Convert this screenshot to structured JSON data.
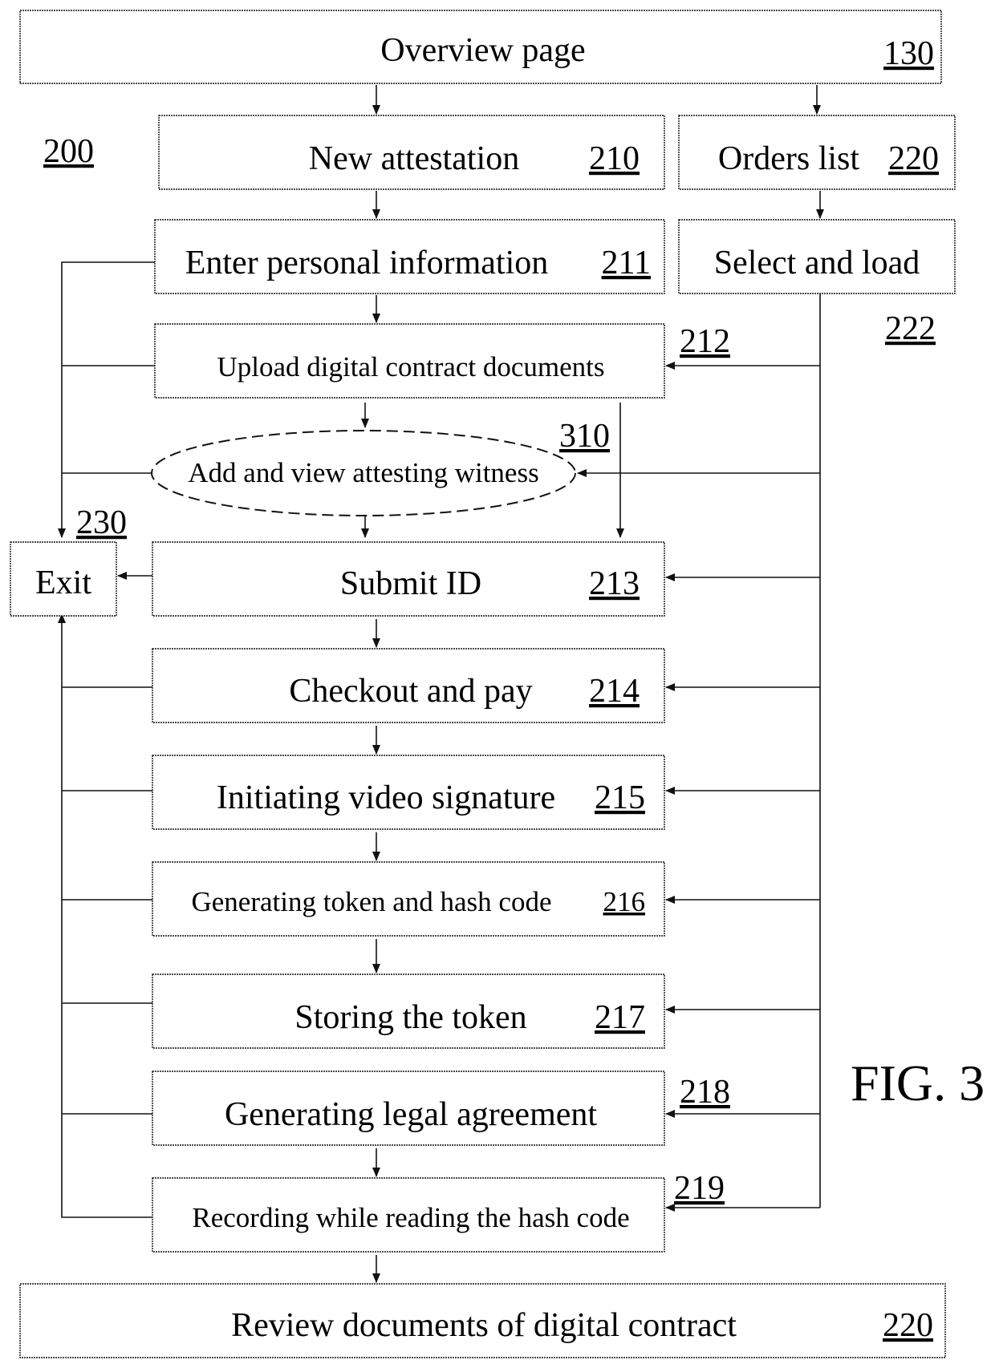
{
  "figure": {
    "title": "FIG. 3",
    "diagram_ref": "200"
  },
  "nodes": {
    "overview": {
      "label": "Overview page",
      "ref": "130"
    },
    "new_attestation": {
      "label": "New attestation",
      "ref": "210"
    },
    "orders_list": {
      "label": "Orders list",
      "ref": "220"
    },
    "enter_info": {
      "label": "Enter personal information",
      "ref": "211"
    },
    "select_load": {
      "label": "Select and load",
      "ref": "222"
    },
    "upload": {
      "label": "Upload digital contract documents",
      "ref": "212"
    },
    "witness": {
      "label": "Add and view attesting witness",
      "ref": "310"
    },
    "exit": {
      "label": "Exit",
      "ref": "230"
    },
    "submit_id": {
      "label": "Submit ID",
      "ref": "213"
    },
    "checkout": {
      "label": "Checkout and pay",
      "ref": "214"
    },
    "video_signature": {
      "label": "Initiating video signature",
      "ref": "215"
    },
    "token_hash": {
      "label": "Generating token and hash code",
      "ref": "216"
    },
    "store_token": {
      "label": "Storing the token",
      "ref": "217"
    },
    "legal_agreement": {
      "label": "Generating legal agreement",
      "ref": "218"
    },
    "recording": {
      "label": "Recording while reading the hash code",
      "ref": "219"
    },
    "review": {
      "label": "Review documents of digital contract",
      "ref": "220"
    }
  }
}
